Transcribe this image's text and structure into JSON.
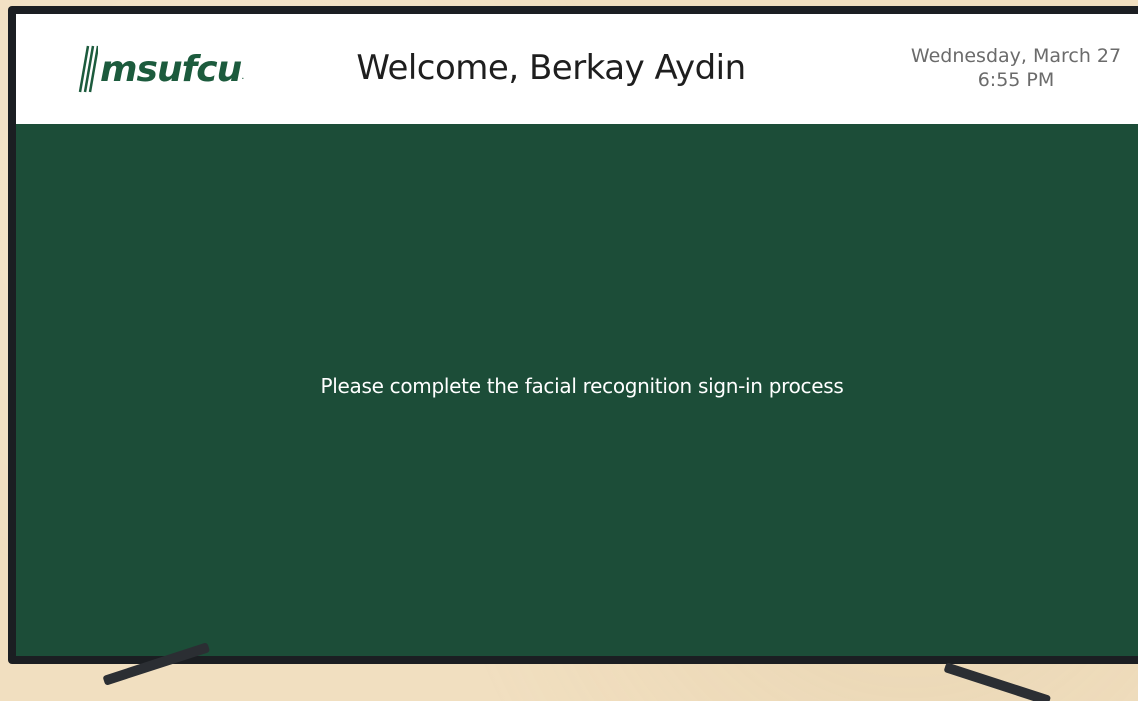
{
  "app": {
    "logo_text": "msufcu",
    "logo_mark": "stripes-icon"
  },
  "header": {
    "welcome": "Welcome, Berkay Aydin",
    "date": "Wednesday, March 27",
    "time": "6:55 PM"
  },
  "main": {
    "message": "Please complete the facial recognition sign-in process"
  },
  "colors": {
    "screen_bg": "#1c4d38",
    "header_bg": "#ffffff",
    "brand_green": "#1c5b3d",
    "wall_bg": "#f1dfc0"
  }
}
